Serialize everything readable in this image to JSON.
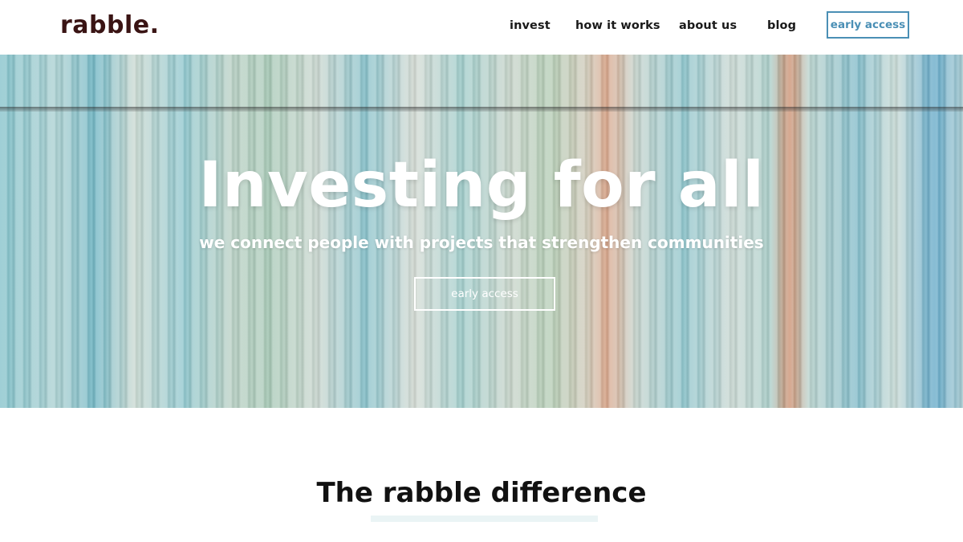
{
  "brand": {
    "name": "rabble."
  },
  "nav": {
    "items": [
      {
        "label": "invest"
      },
      {
        "label": "how it works"
      },
      {
        "label": "about us"
      },
      {
        "label": "blog"
      }
    ],
    "cta_label": "early access"
  },
  "hero": {
    "title": "Investing for all",
    "subtitle": "we connect people with projects that strengthen communities",
    "cta_label": "early access"
  },
  "section": {
    "title": "The rabble difference"
  },
  "colors": {
    "accent": "#4a8fb5",
    "logo": "#3a1414",
    "underline": "#eaf4f5"
  }
}
